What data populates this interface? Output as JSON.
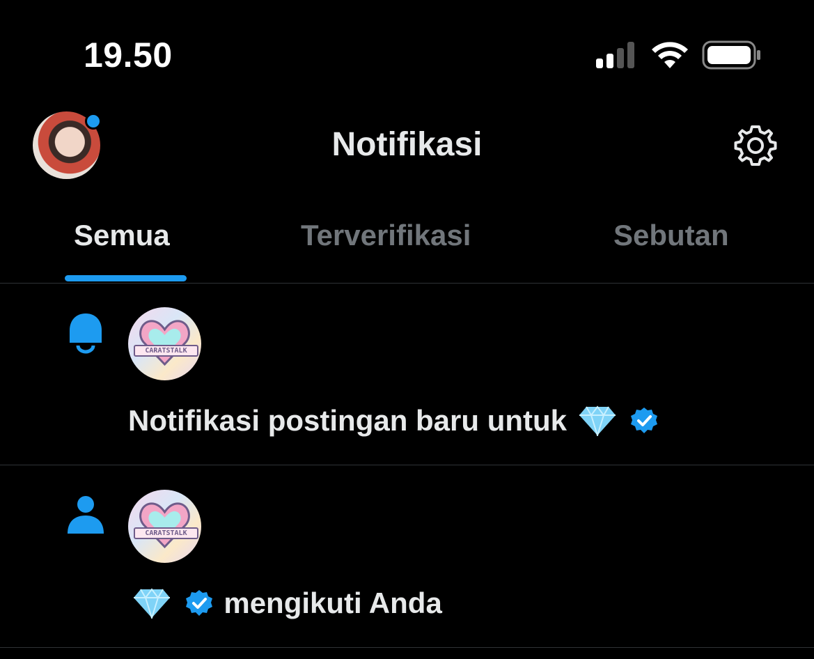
{
  "status_bar": {
    "time": "19.50"
  },
  "header": {
    "title": "Notifikasi"
  },
  "tabs": [
    {
      "label": "Semua",
      "active": true
    },
    {
      "label": "Terverifikasi",
      "active": false
    },
    {
      "label": "Sebutan",
      "active": false
    }
  ],
  "notifications": [
    {
      "type_icon": "bell-icon",
      "account_avatar_text": "CARATSTALK",
      "text_before": "Notifikasi postingan baru untuk",
      "text_after": ""
    },
    {
      "type_icon": "person-icon",
      "account_avatar_text": "CARATSTALK",
      "text_before": "",
      "text_after": "mengikuti Anda"
    }
  ],
  "colors": {
    "accent": "#1d9bf0",
    "background": "#000000",
    "text": "#e7e9ea",
    "muted": "#71767b",
    "divider": "#2f3336"
  }
}
